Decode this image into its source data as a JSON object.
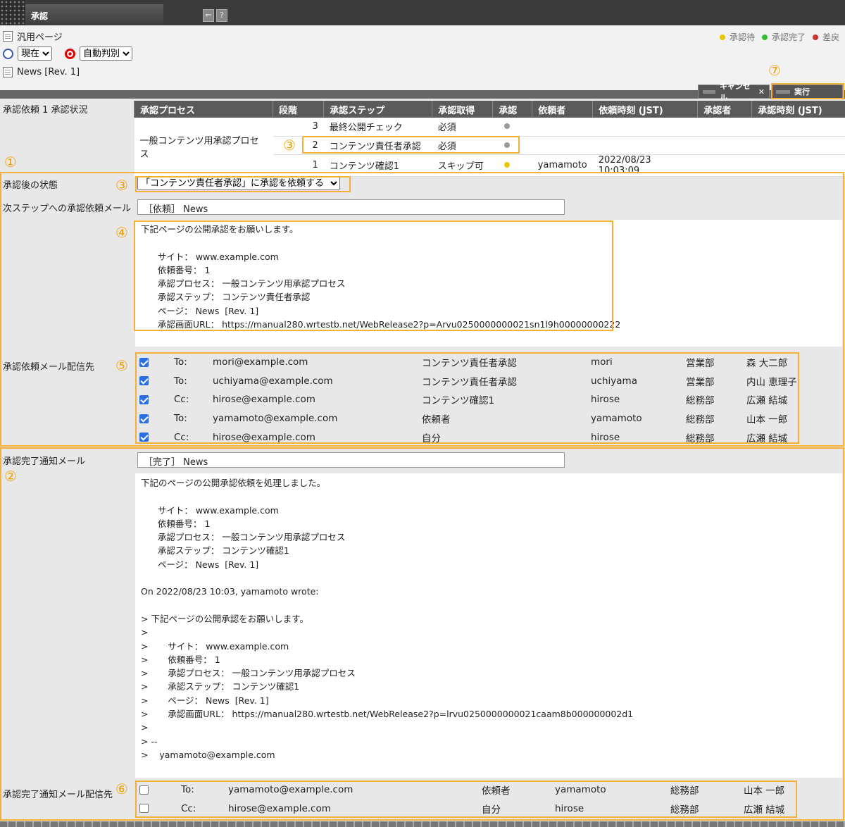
{
  "window": {
    "title": "承認",
    "back_icon": "back-icon",
    "help_icon": "help-icon",
    "help_glyph": "?"
  },
  "header": {
    "page_type": "汎用ページ",
    "time_select": "現在",
    "mode_select": "自動判別",
    "page_name": "News [Rev. 1]"
  },
  "legend": [
    {
      "label": "承認待",
      "color": "#e6c800"
    },
    {
      "label": "承認完了",
      "color": "#33bb33"
    },
    {
      "label": "差戻",
      "color": "#cc3333"
    }
  ],
  "actions": {
    "cancel": "キャンセル",
    "cancel_x": "✕",
    "execute": "実行"
  },
  "annotations": [
    "①",
    "②",
    "③",
    "④",
    "⑤",
    "⑥",
    "⑦"
  ],
  "status_label": "承認依頼 1 承認状況",
  "process_table": {
    "headers": [
      "承認プロセス",
      "段階",
      "承認ステップ",
      "承認取得",
      "承認",
      "依頼者",
      "依頼時刻 (JST)",
      "承認者",
      "承認時刻 (JST)"
    ],
    "process_name": "一般コンテンツ用承認プロセス",
    "rows": [
      {
        "stage": "3",
        "step": "最終公開チェック",
        "acquire": "必須",
        "status_color": "#999999",
        "requester": "",
        "time": ""
      },
      {
        "stage": "2",
        "step": "コンテンツ責任者承認",
        "acquire": "必須",
        "status_color": "#999999",
        "requester": "",
        "time": ""
      },
      {
        "stage": "1",
        "step": "コンテンツ確認1",
        "acquire": "スキップ可",
        "status_color": "#e6c800",
        "requester": "yamamoto",
        "time": "2022/08/23 10:03:09"
      }
    ]
  },
  "after_state": {
    "label": "承認後の状態",
    "value": "「コンテンツ責任者承認」に承認を依頼する"
  },
  "request_mail": {
    "label": "次ステップへの承認依頼メール",
    "subject": "［依頼］ News",
    "body": "下記ページの公開承認をお願いします。\n\n      サイト： www.example.com\n      依頼番号： 1\n      承認プロセス： 一般コンテンツ用承認プロセス\n      承認ステップ： コンテンツ責任者承認\n      ページ： News  [Rev. 1]\n      承認画面URL： https://manual280.wrtestb.net/WebRelease2?p=Arvu0250000000021sn1l9h00000000222"
  },
  "request_recipients": {
    "label": "承認依頼メール配信先",
    "rows": [
      {
        "checked": true,
        "type": "To:",
        "email": "mori@example.com",
        "role": "コンテンツ責任者承認",
        "user": "mori",
        "dept": "営業部",
        "name": "森 大二郎"
      },
      {
        "checked": true,
        "type": "To:",
        "email": "uchiyama@example.com",
        "role": "コンテンツ責任者承認",
        "user": "uchiyama",
        "dept": "営業部",
        "name": "内山 恵理子"
      },
      {
        "checked": true,
        "type": "Cc:",
        "email": "hirose@example.com",
        "role": "コンテンツ確認1",
        "user": "hirose",
        "dept": "総務部",
        "name": "広瀬 結城"
      },
      {
        "checked": true,
        "type": "To:",
        "email": "yamamoto@example.com",
        "role": "依頼者",
        "user": "yamamoto",
        "dept": "総務部",
        "name": "山本 一郎"
      },
      {
        "checked": true,
        "type": "Cc:",
        "email": "hirose@example.com",
        "role": "自分",
        "user": "hirose",
        "dept": "総務部",
        "name": "広瀬 結城"
      }
    ]
  },
  "complete_mail": {
    "label": "承認完了通知メール",
    "subject": "［完了］ News",
    "body": "下記のページの公開承認依頼を処理しました。\n\n      サイト： www.example.com\n      依頼番号： 1\n      承認プロセス： 一般コンテンツ用承認プロセス\n      承認ステップ： コンテンツ確認1\n      ページ： News  [Rev. 1]\n\nOn 2022/08/23 10:03, yamamoto wrote:\n\n> 下記ページの公開承認をお願いします。\n>\n>       サイト： www.example.com\n>       依頼番号： 1\n>       承認プロセス： 一般コンテンツ用承認プロセス\n>       承認ステップ： コンテンツ確認1\n>       ページ： News  [Rev. 1]\n>       承認画面URL： https://manual280.wrtestb.net/WebRelease2?p=lrvu0250000000021caam8b000000002d1\n>\n> --\n>    yamamoto@example.com"
  },
  "complete_recipients": {
    "label": "承認完了通知メール配信先",
    "rows": [
      {
        "checked": false,
        "type": "To:",
        "email": "yamamoto@example.com",
        "role": "依頼者",
        "user": "yamamoto",
        "dept": "総務部",
        "name": "山本 一郎"
      },
      {
        "checked": false,
        "type": "Cc:",
        "email": "hirose@example.com",
        "role": "自分",
        "user": "hirose",
        "dept": "総務部",
        "name": "広瀬 結城"
      }
    ]
  }
}
